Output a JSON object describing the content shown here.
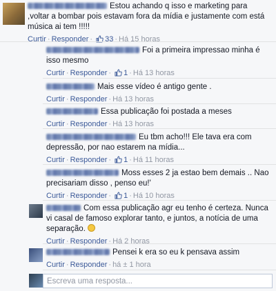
{
  "comment": {
    "text": "Estou achando q isso e marketing para ,voltar a bombar pois estavam fora da mídia e justamente com está música ai tem !!!!!",
    "action_reply_label": "Curtir",
    "action_respond_label": "Responder",
    "likes": "33",
    "time": "Há 15 horas"
  },
  "replies": [
    {
      "text": "Foi a primeira impressao minha é isso mesmo",
      "curtir": "Curtir",
      "responder": "Responder",
      "likes": "1",
      "time": "Há 13 horas"
    },
    {
      "text": "Mais esse vídeo é antigo gente .",
      "curtir": "Curtir",
      "responder": "Responder",
      "time": "Há 13 horas"
    },
    {
      "text": "Essa publicação foi postada a meses",
      "curtir": "Curtir",
      "responder": "Responder",
      "time": "Há 13 horas"
    },
    {
      "text": "Eu tbm acho!!! Ele tava era com depressão, por nao estarem na mídia...",
      "curtir": "Curtir",
      "responder": "Responder",
      "likes": "1",
      "time": "Há 11 horas"
    },
    {
      "text": "Moss esses 2 ja estao bem demais .. Nao precisariam disso , penso eu!'",
      "curtir": "Curtir",
      "responder": "Responder",
      "likes": "1",
      "time": "Há 10 horas"
    },
    {
      "text": "Com essa publicação agr eu tenho é certeza. Nunca vi casal de famoso explorar tanto, e juntos, a notícia de uma separação.",
      "curtir": "Curtir",
      "responder": "Responder",
      "time": "Há 2 horas"
    },
    {
      "text": "Pensei k era so eu k pensava assim",
      "curtir": "Curtir",
      "responder": "Responder",
      "time": "há ± 1 hora"
    }
  ],
  "reply_input": {
    "placeholder": "Escreva uma resposta..."
  },
  "colors": {
    "link": "#3b5998",
    "meta": "#9197a3",
    "background": "#f6f7f9"
  },
  "icons": [
    "thumbs-up-icon",
    "smiley-emoji-icon"
  ]
}
